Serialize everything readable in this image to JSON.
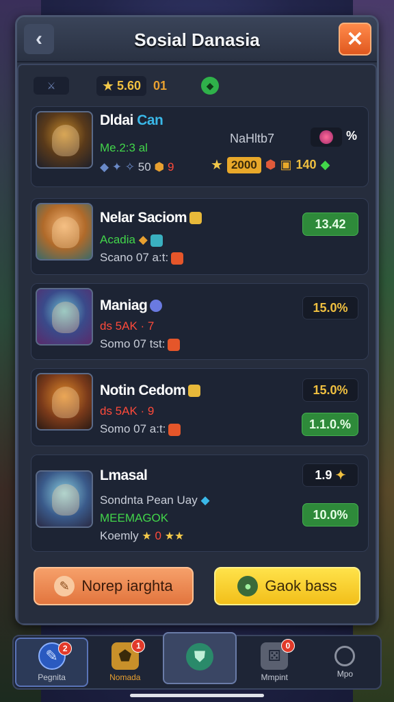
{
  "header": {
    "title": "Sosial Danasia",
    "back_icon": "‹",
    "close_icon": "✕"
  },
  "toprow": {
    "gold_value": "5.60",
    "gold_suffix": "01"
  },
  "cards": [
    {
      "name": "Dldai",
      "name_accent": "Can",
      "sub1": "Me.2:3 al",
      "stat_a": "50",
      "stat_b": "9",
      "right_label": "NaHltb7",
      "right_pct": "%",
      "gold": "2000",
      "chest": "140"
    },
    {
      "name": "Nelar Saciom",
      "sub1": "Acadia",
      "sub2": "Scano 07 a:t:",
      "badge": "13.42"
    },
    {
      "name": "Maniag",
      "sub1": "ds 5AK · 7",
      "sub2": "Somo 07 tst:",
      "badge": "15.0%"
    },
    {
      "name": "Notin Cedom",
      "sub1": "ds 5AK · 9",
      "sub2": "Somo 07 a:t:",
      "badge_top": "15.0%",
      "badge_bottom": "1.1.0.%"
    },
    {
      "name": "Lmasal",
      "sub1": "Sondnta Pean Uay",
      "sub2": "MEEMAGOK",
      "sub3": "Koemly",
      "sub3_value": "0",
      "badge_top": "1.9",
      "badge_bottom": "10.0%"
    }
  ],
  "buttons": {
    "left": "Norep iarghta",
    "right": "Gaok bass"
  },
  "nav": [
    {
      "label": "Pegnita",
      "badge": "2"
    },
    {
      "label": "Nomada",
      "badge": "1"
    },
    {
      "label": ""
    },
    {
      "label": "Mmpint",
      "badge": "0"
    },
    {
      "label": "Mpo"
    }
  ],
  "colors": {
    "accent_orange": "#e2753e",
    "accent_yellow": "#f2bf1a",
    "positive_green": "#2e8a3a"
  }
}
